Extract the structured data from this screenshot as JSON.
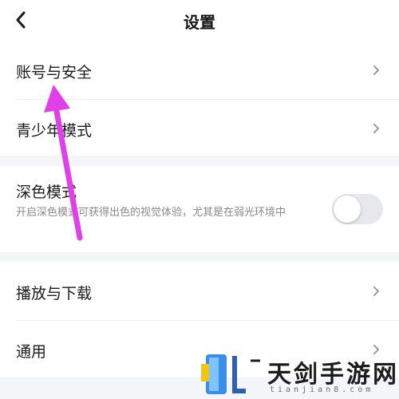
{
  "header": {
    "title": "设置"
  },
  "rows": {
    "account_security": "账号与安全",
    "teen_mode": "青少年模式",
    "dark_mode": "深色模式",
    "dark_mode_desc": "开启深色模式可获得出色的视觉体验，尤其是在弱光环境中",
    "dark_mode_enabled": false,
    "play_download": "播放与下载",
    "general": "通用"
  },
  "watermark": {
    "name": "天剑手游网",
    "url": "tianjian8.com"
  },
  "colors": {
    "annotation_arrow": "#e040e8",
    "page_bg": "#f3f5f9",
    "text": "#1b1b1b",
    "subtext": "#8a8a8a"
  },
  "icons": {
    "back": "chevron-left-icon",
    "row_arrow": "chevron-right-icon"
  }
}
